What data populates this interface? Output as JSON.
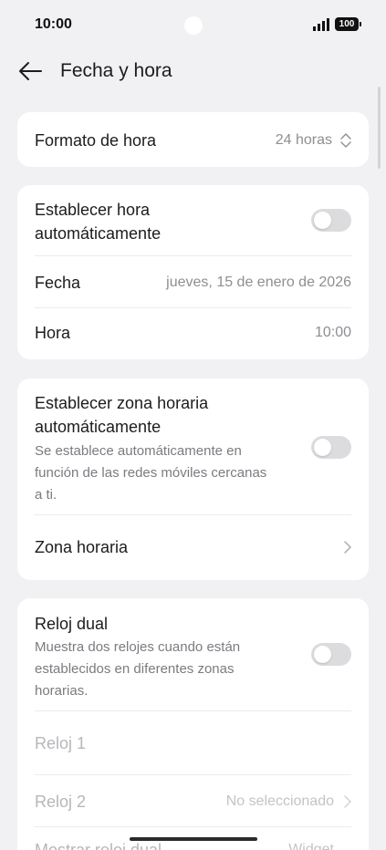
{
  "status_bar": {
    "time": "10:00",
    "battery": "100"
  },
  "header": {
    "title": "Fecha y hora"
  },
  "time_format": {
    "label": "Formato de hora",
    "value": "24 horas"
  },
  "auto_time": {
    "label_line1": "Establecer hora",
    "label_line2": "automáticamente",
    "toggle_on": false
  },
  "date": {
    "label": "Fecha",
    "value": "jueves, 15 de enero de 2026"
  },
  "time": {
    "label": "Hora",
    "value": "10:00"
  },
  "auto_timezone": {
    "label_line1": "Establecer zona horaria",
    "label_line2": "automáticamente",
    "desc_line1": "Se establece automáticamente en",
    "desc_line2": "función de las redes móviles cercanas",
    "desc_line3": "a ti.",
    "toggle_on": false
  },
  "timezone": {
    "label": "Zona horaria"
  },
  "dual_clock": {
    "label": "Reloj dual",
    "desc_line1": "Muestra dos relojes cuando están",
    "desc_line2": "establecidos en diferentes zonas",
    "desc_line3": "horarias.",
    "toggle_on": false,
    "clock1_label": "Reloj 1",
    "clock2_label": "Reloj 2",
    "clock2_value": "No seleccionado",
    "show_label": "Mostrar reloj dual",
    "show_value": "Widget"
  }
}
